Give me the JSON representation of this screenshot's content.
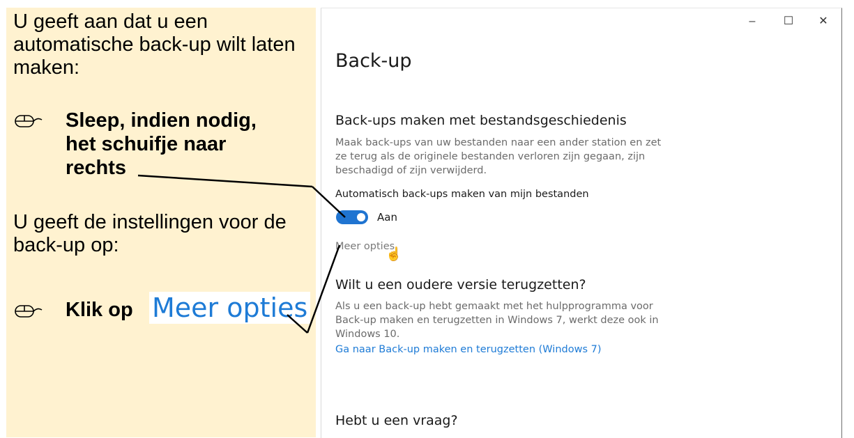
{
  "instructions": {
    "intro_1": "U geeft aan dat u een automatische back-up wilt laten maken:",
    "step_1": "Sleep, indien nodig,\nhet schuifje naar\nrechts",
    "intro_2": "U geeft de instellingen voor de back-up op:",
    "step_2_prefix": "Klik op",
    "step_2_link": "Meer opties"
  },
  "window": {
    "minimize_glyph": "–",
    "maximize_glyph": "☐",
    "close_glyph": "✕",
    "title": "Back-up",
    "section_1": {
      "heading": "Back-ups maken met bestandsgeschiedenis",
      "description": "Maak back-ups van uw bestanden naar een ander station en zet ze terug als de originele bestanden verloren zijn gegaan, zijn beschadigd of zijn verwijderd.",
      "toggle_label": "Automatisch back-ups maken van mijn bestanden",
      "toggle_state": "Aan",
      "toggle_on": true,
      "more_options": "Meer opties"
    },
    "section_2": {
      "heading": "Wilt u een oudere versie terugzetten?",
      "description": "Als u een back-up hebt gemaakt met het hulpprogramma voor Back-up maken en terugzetten in Windows 7, werkt deze ook in Windows 10.",
      "link": "Ga naar Back-up maken en terugzetten (Windows 7)"
    },
    "section_3": {
      "heading": "Hebt u een vraag?"
    }
  },
  "colors": {
    "panel_bg": "#fff2d0",
    "accent": "#1f74d1",
    "link": "#1e7bd6"
  },
  "icons": {
    "mouse": "mouse-icon",
    "hand_cursor": "hand-cursor-icon"
  }
}
